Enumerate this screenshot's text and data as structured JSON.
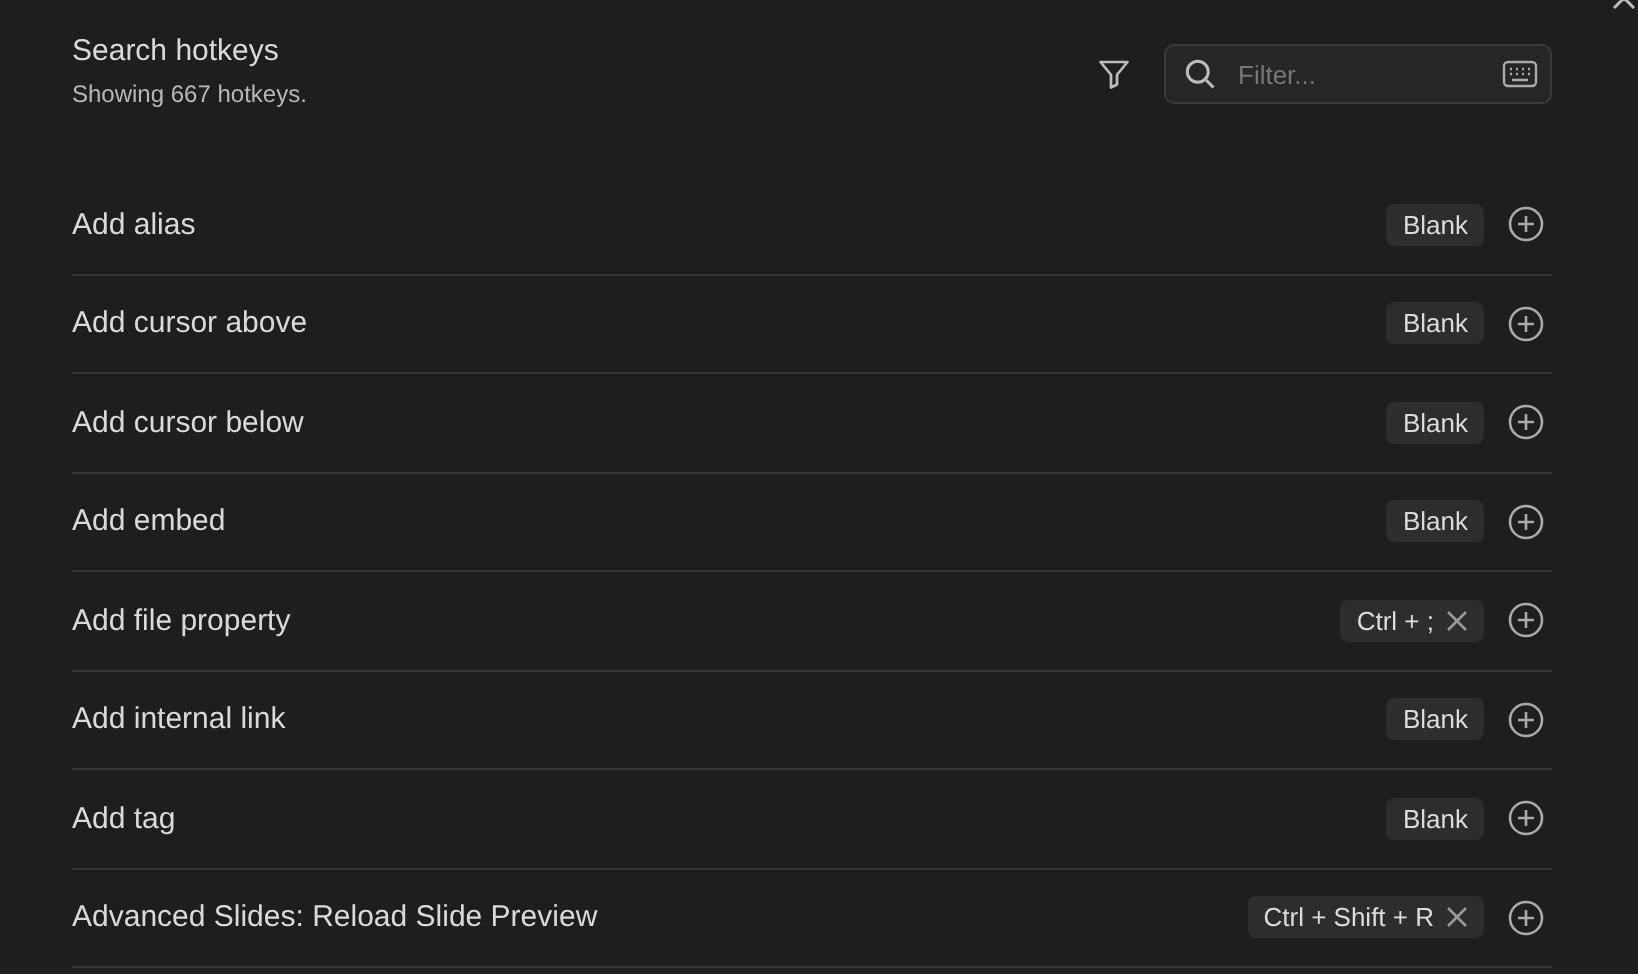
{
  "header": {
    "title": "Search hotkeys",
    "subtitle": "Showing 667 hotkeys."
  },
  "filter": {
    "placeholder": "Filter..."
  },
  "rows": [
    {
      "name": "Add alias",
      "hotkey": {
        "kind": "blank",
        "label": "Blank"
      }
    },
    {
      "name": "Add cursor above",
      "hotkey": {
        "kind": "blank",
        "label": "Blank"
      }
    },
    {
      "name": "Add cursor below",
      "hotkey": {
        "kind": "blank",
        "label": "Blank"
      }
    },
    {
      "name": "Add embed",
      "hotkey": {
        "kind": "blank",
        "label": "Blank"
      }
    },
    {
      "name": "Add file property",
      "hotkey": {
        "kind": "set",
        "label": "Ctrl + ;"
      }
    },
    {
      "name": "Add internal link",
      "hotkey": {
        "kind": "blank",
        "label": "Blank"
      }
    },
    {
      "name": "Add tag",
      "hotkey": {
        "kind": "blank",
        "label": "Blank"
      }
    },
    {
      "name": "Advanced Slides: Reload Slide Preview",
      "hotkey": {
        "kind": "set",
        "label": "Ctrl + Shift + R"
      }
    }
  ]
}
